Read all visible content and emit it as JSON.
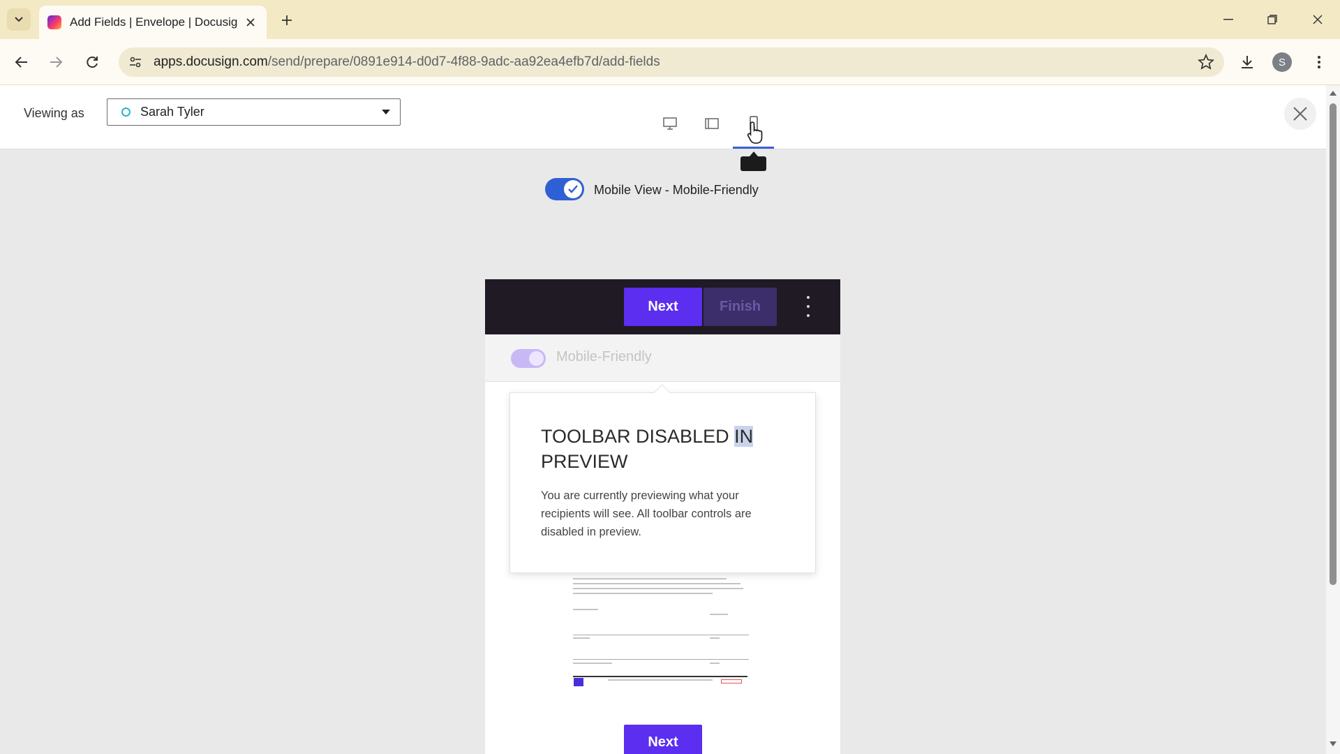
{
  "browser": {
    "tab_title": "Add Fields | Envelope | Docusign",
    "url_host": "apps.docusign.com",
    "url_path": "/send/prepare/0891e914-d0d7-4f88-9adc-aa92ea4efb7d/add-fields",
    "profile_initial": "S"
  },
  "header": {
    "viewing_as_label": "Viewing as",
    "recipient": "Sarah Tyler",
    "selected_view": "mobile"
  },
  "preview": {
    "mobile_view_toggle_label": "Mobile View - Mobile-Friendly",
    "mobile_view_enabled": true,
    "next_label": "Next",
    "finish_label": "Finish",
    "mobile_friendly_label": "Mobile-Friendly",
    "popover": {
      "title_part1": "TOOLBAR DISABLED ",
      "title_highlight": "IN",
      "title_part2": "PREVIEW",
      "body": "You are currently previewing what your recipients will see. All toolbar controls are disabled in preview."
    },
    "next_bottom_label": "Next"
  },
  "colors": {
    "accent": "#5b2ef0",
    "toggle_blue": "#2f5fd4",
    "chrome_bg": "#f3e9c5"
  }
}
